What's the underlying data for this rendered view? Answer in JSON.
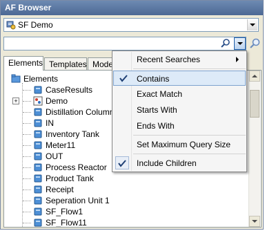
{
  "window": {
    "title": "AF Browser"
  },
  "server": {
    "selected": "SF Demo"
  },
  "search": {
    "value": "",
    "placeholder": ""
  },
  "tabs": [
    {
      "label": "Elements",
      "active": true
    },
    {
      "label": "Templates",
      "active": false
    },
    {
      "label": "Model",
      "active": false
    }
  ],
  "tree": {
    "root": "Elements",
    "children": [
      "CaseResults",
      "Demo",
      "Distillation Column",
      "IN",
      "Inventory Tank",
      "Meter11",
      "OUT",
      "Process Reactor",
      "Product Tank",
      "Receipt",
      "Seperation Unit 1",
      "SF_Flow1",
      "SF_Flow11"
    ]
  },
  "menu": {
    "items": [
      {
        "label": "Recent Searches",
        "submenu": true,
        "checked": false
      },
      {
        "label": "Contains",
        "checked": true,
        "highlighted": true
      },
      {
        "label": "Exact Match",
        "checked": false
      },
      {
        "label": "Starts With",
        "checked": false
      },
      {
        "label": "Ends With",
        "checked": false
      },
      {
        "label": "Set Maximum Query Size",
        "checked": false
      },
      {
        "label": "Include Children",
        "checked": true
      }
    ]
  },
  "colors": {
    "title_bar": "#5a78a4",
    "highlight": "#ddeaf8",
    "folder": "#4d8fd6"
  }
}
